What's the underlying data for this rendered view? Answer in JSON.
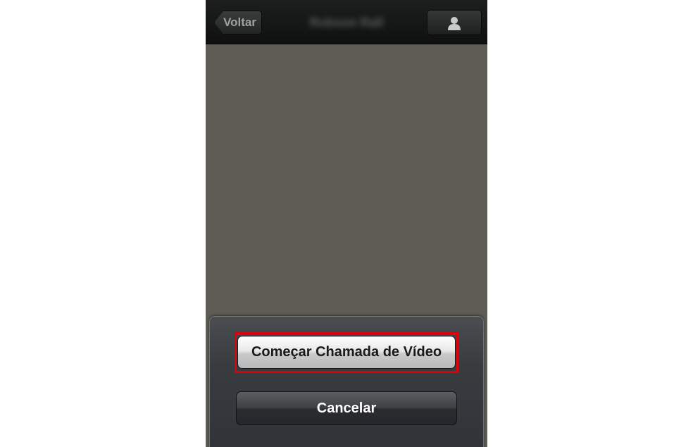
{
  "navbar": {
    "back_label": "Voltar",
    "title": "Robson Rall"
  },
  "action_sheet": {
    "video_call_label": "Começar Chamada de Vídeo",
    "cancel_label": "Cancelar"
  },
  "icons": {
    "contact": "person-icon"
  },
  "colors": {
    "content_bg": "#5e5d55",
    "navbar_bg": "#141515",
    "highlight": "#e0000b"
  }
}
